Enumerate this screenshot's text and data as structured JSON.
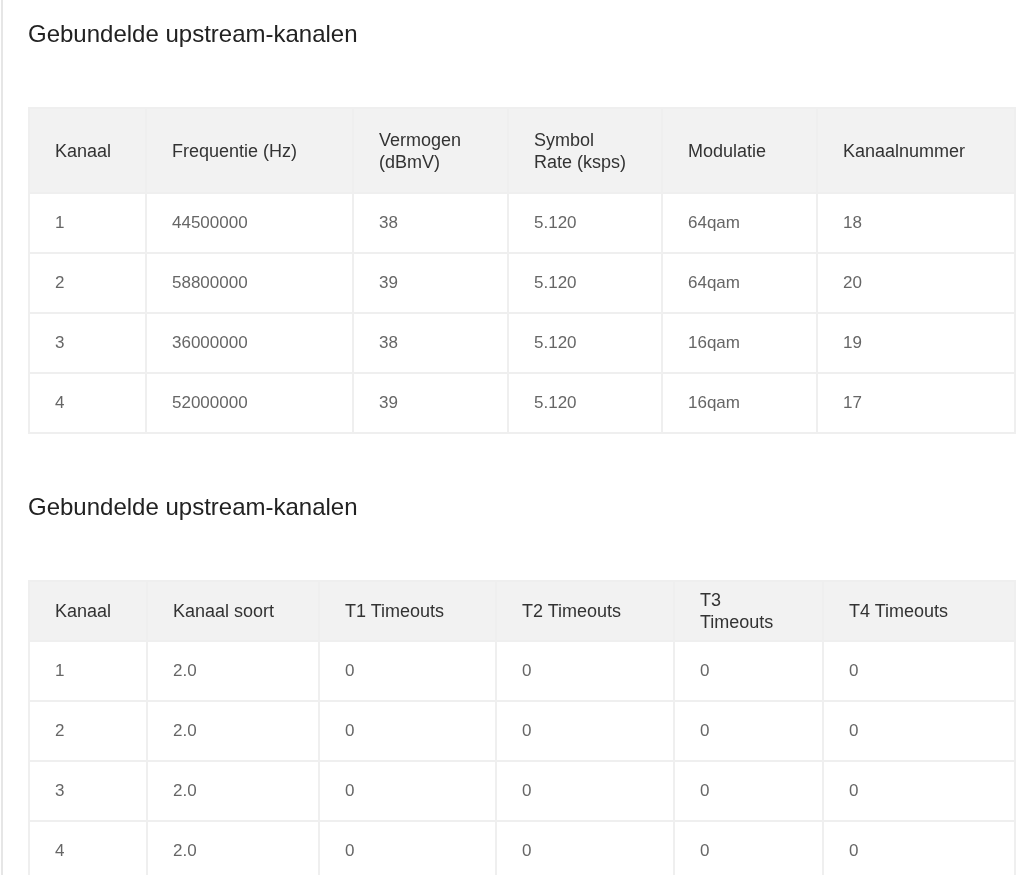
{
  "sections": [
    {
      "title": "Gebundelde upstream-kanalen",
      "columns": [
        "Kanaal",
        "Frequentie (Hz)",
        "Vermogen (dBmV)",
        "Symbol Rate (ksps)",
        "Modulatie",
        "Kanaalnummer"
      ],
      "rows": [
        [
          "1",
          "44500000",
          "38",
          "5.120",
          "64qam",
          "18"
        ],
        [
          "2",
          "58800000",
          "39",
          "5.120",
          "64qam",
          "20"
        ],
        [
          "3",
          "36000000",
          "38",
          "5.120",
          "16qam",
          "19"
        ],
        [
          "4",
          "52000000",
          "39",
          "5.120",
          "16qam",
          "17"
        ]
      ]
    },
    {
      "title": "Gebundelde upstream-kanalen",
      "columns": [
        "Kanaal",
        "Kanaal soort",
        "T1 Timeouts",
        "T2 Timeouts",
        "T3 Timeouts",
        "T4 Timeouts"
      ],
      "rows": [
        [
          "1",
          "2.0",
          "0",
          "0",
          "0",
          "0"
        ],
        [
          "2",
          "2.0",
          "0",
          "0",
          "0",
          "0"
        ],
        [
          "3",
          "2.0",
          "0",
          "0",
          "0",
          "0"
        ],
        [
          "4",
          "2.0",
          "0",
          "0",
          "0",
          "0"
        ]
      ]
    }
  ]
}
